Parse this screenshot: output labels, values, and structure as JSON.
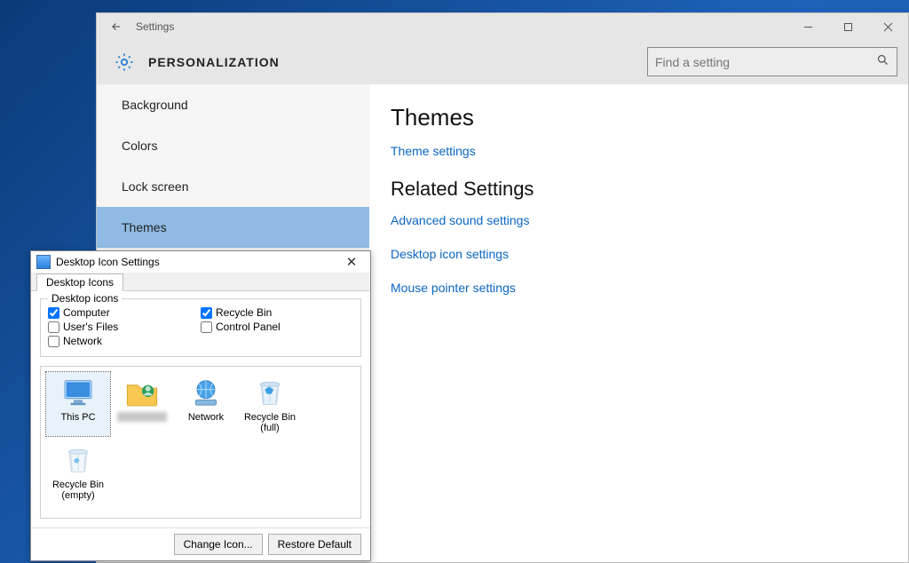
{
  "settings": {
    "app_title": "Settings",
    "page_heading": "PERSONALIZATION",
    "search_placeholder": "Find a setting",
    "sidebar": [
      {
        "label": "Background",
        "selected": false
      },
      {
        "label": "Colors",
        "selected": false
      },
      {
        "label": "Lock screen",
        "selected": false
      },
      {
        "label": "Themes",
        "selected": true
      }
    ],
    "content": {
      "heading1": "Themes",
      "link1": "Theme settings",
      "heading2": "Related Settings",
      "links2": [
        "Advanced sound settings",
        "Desktop icon settings",
        "Mouse pointer settings"
      ]
    }
  },
  "dialog": {
    "title": "Desktop Icon Settings",
    "tab_label": "Desktop Icons",
    "group_label": "Desktop icons",
    "checks": {
      "computer": {
        "label": "Computer",
        "checked": true
      },
      "users_files": {
        "label": "User's Files",
        "checked": false
      },
      "network": {
        "label": "Network",
        "checked": false
      },
      "recycle_bin": {
        "label": "Recycle Bin",
        "checked": true
      },
      "control_panel": {
        "label": "Control Panel",
        "checked": false
      }
    },
    "preview": [
      {
        "name": "this-pc",
        "label": "This PC",
        "icon": "monitor",
        "selected": true
      },
      {
        "name": "user-folder",
        "label": "",
        "icon": "user-folder",
        "selected": false,
        "blurred": true
      },
      {
        "name": "network",
        "label": "Network",
        "icon": "network",
        "selected": false
      },
      {
        "name": "recycle-full",
        "label": "Recycle Bin (full)",
        "icon": "bin-full",
        "selected": false
      },
      {
        "name": "recycle-empty",
        "label": "Recycle Bin (empty)",
        "icon": "bin-empty",
        "selected": false
      }
    ],
    "buttons": {
      "change_icon": "Change Icon...",
      "restore_default": "Restore Default"
    }
  }
}
